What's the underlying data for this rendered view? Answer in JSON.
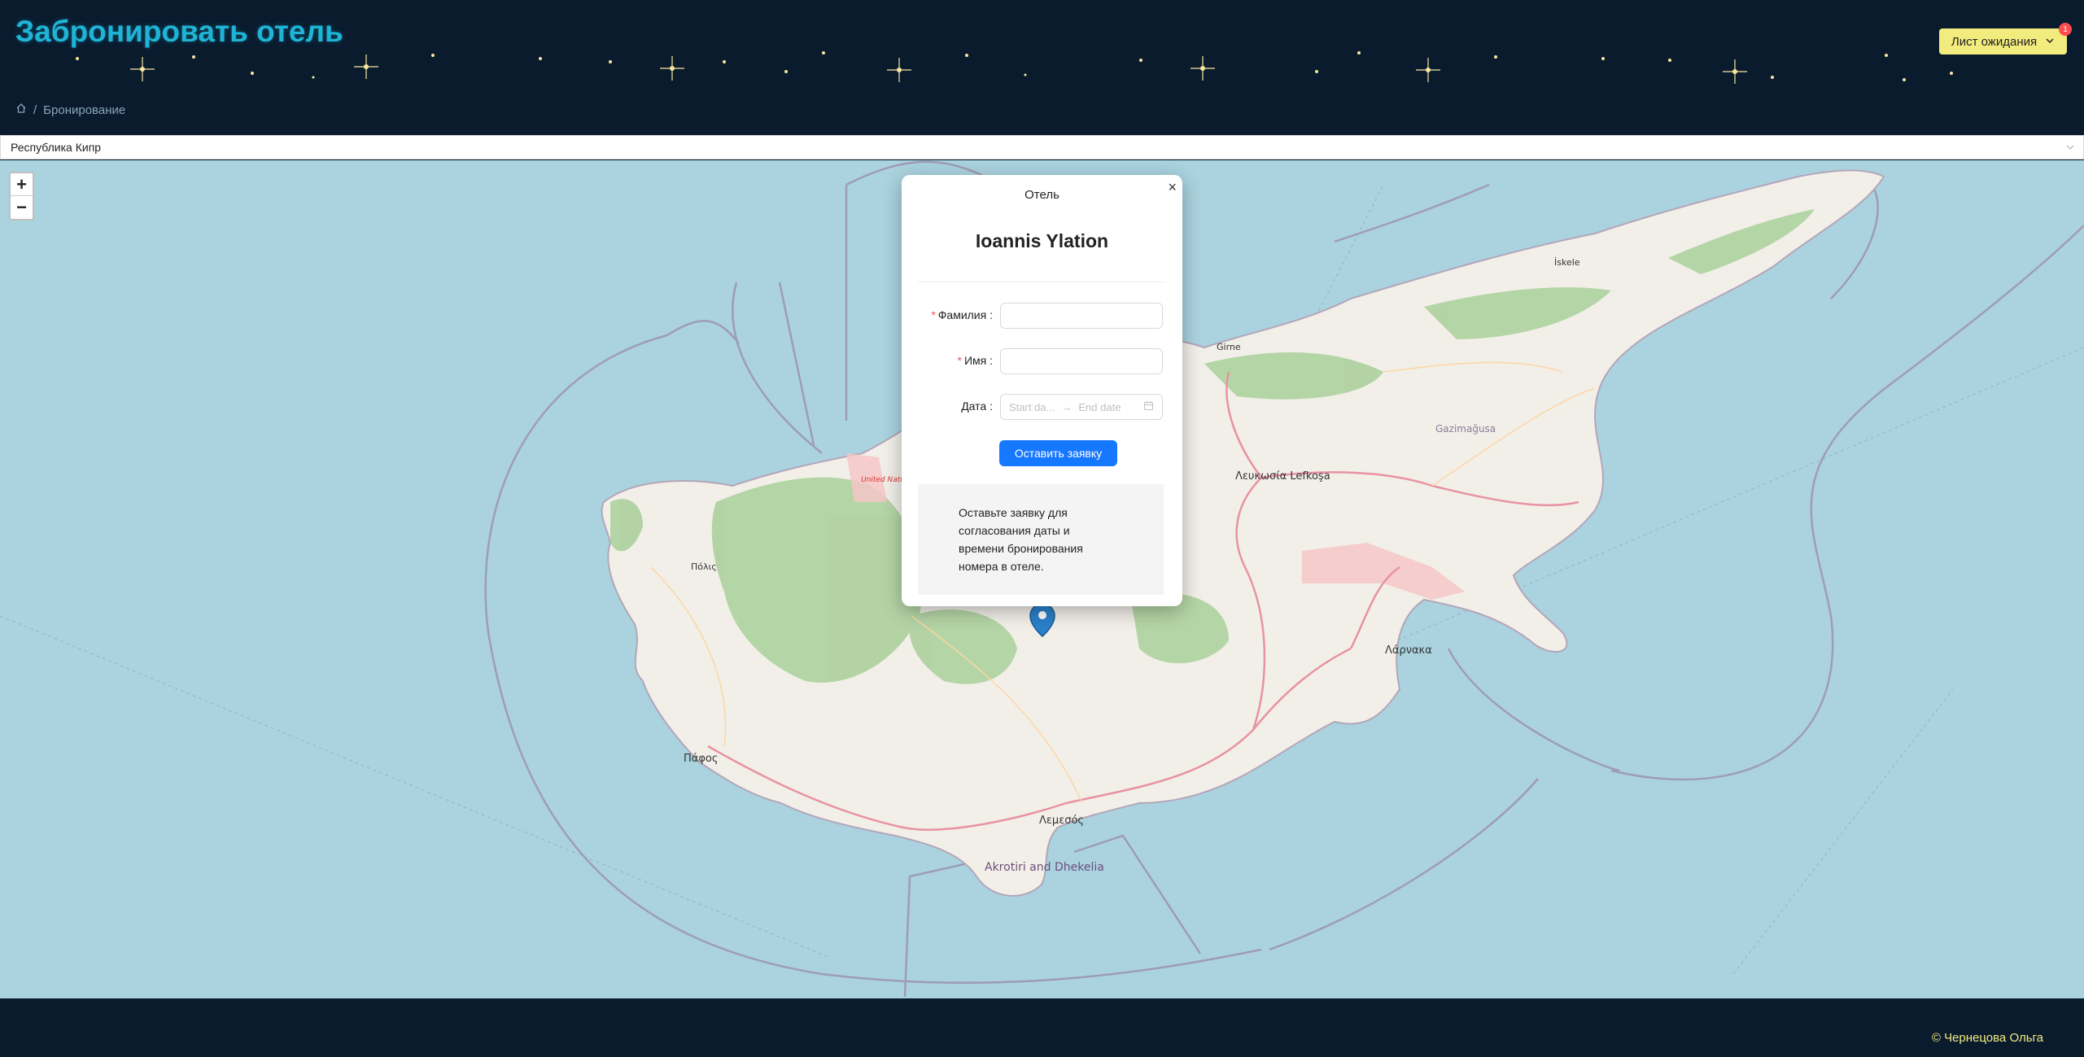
{
  "header": {
    "title": "Забронировать отель",
    "waitlist_label": "Лист ожидания",
    "waitlist_badge": "1"
  },
  "breadcrumb": {
    "current": "Бронирование"
  },
  "country_select": {
    "value": "Республика Кипр"
  },
  "map": {
    "zoom_in": "+",
    "zoom_out": "−",
    "labels": {
      "girne": "Girne",
      "lefkosa": "Λευκωσία Lefkoşa",
      "gazimagusa": "Gazimağusa",
      "larnaka": "Λάρνακα",
      "lemesos": "Λεμεσός",
      "pafos": "Πάφος",
      "akrotiri": "Akrotiri and Dhekelia",
      "iskele": "İskele",
      "polis": "Πόλις",
      "un_zone": "United Nations Buffer Zone Sector"
    }
  },
  "popup": {
    "title": "Отель",
    "hotel_name": "Ioannis Ylation",
    "surname_label": "Фамилия",
    "name_label": "Имя",
    "date_label": "Дата",
    "start_placeholder": "Start da...",
    "end_placeholder": "End date",
    "submit_label": "Оставить заявку",
    "note": "Оставьте заявку для согласования даты и времени бронирования номера в отеле."
  },
  "footer": {
    "copyright": "© Чернецова Ольга"
  },
  "colors": {
    "header_bg": "#0a1b2e",
    "title": "#1fb4d6",
    "waitlist_bg": "#f2eb7d",
    "primary": "#1677ff",
    "sea": "#aad3df",
    "land": "#f2efe9"
  }
}
